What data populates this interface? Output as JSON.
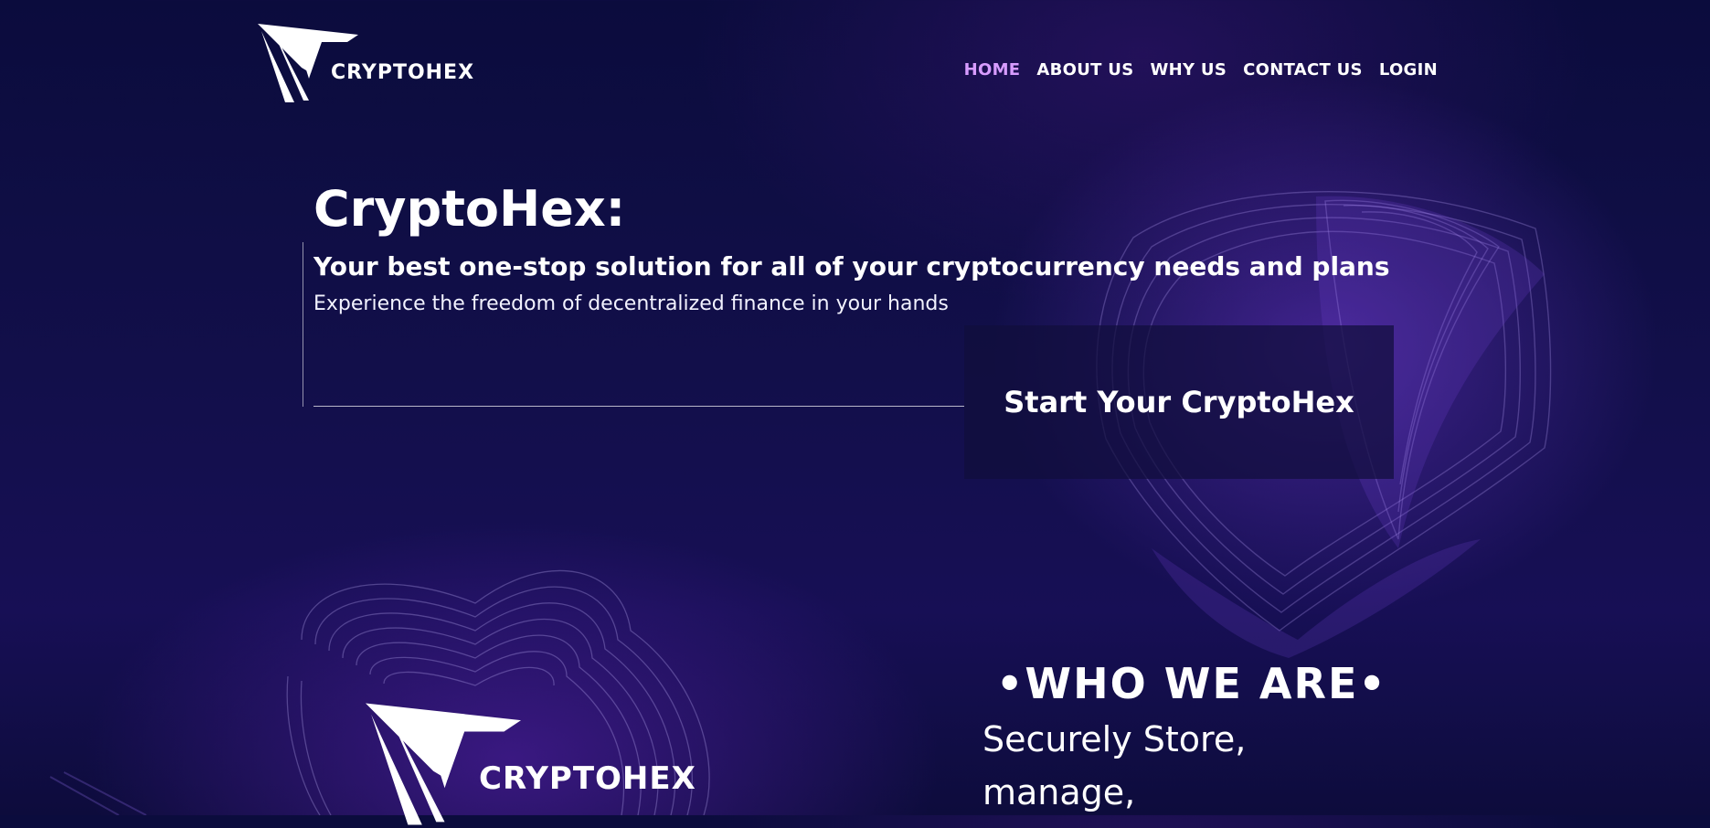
{
  "header": {
    "logo_text": "CRYPTOHEX",
    "nav": [
      {
        "label": "HOME",
        "active": true
      },
      {
        "label": "ABOUT US",
        "active": false
      },
      {
        "label": "WHY US",
        "active": false
      },
      {
        "label": "CONTACT US",
        "active": false
      },
      {
        "label": "LOGIN",
        "active": false
      }
    ]
  },
  "hero": {
    "title": "CryptoHex:",
    "subtitle": "Your best one-stop solution for all of your cryptocurrency needs and plans",
    "description": "Experience the freedom of decentralized finance in your hands",
    "cta_label": "Start Your CryptoHex"
  },
  "who": {
    "logo_text": "CRYPTOHEX",
    "heading": "•WHO WE ARE•",
    "text": "Securely Store, manage,"
  },
  "colors": {
    "background": "#0b0c3d",
    "nav_active": "#d79cff",
    "text": "#ffffff",
    "accent_purple": "#6834c8"
  },
  "icons": {
    "logo": "cryptohex-triangle-logo"
  }
}
